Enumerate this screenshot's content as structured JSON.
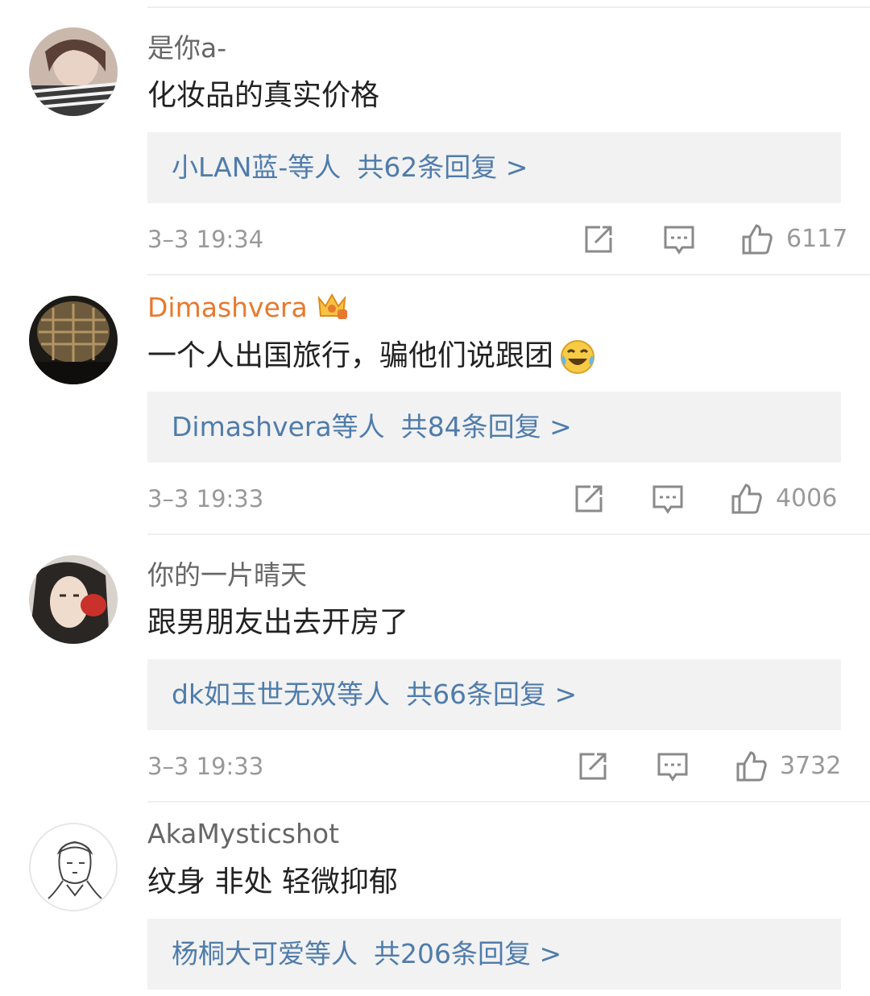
{
  "comments": [
    {
      "username": "是你a-",
      "vip": false,
      "text": "化妆品的真实价格",
      "reply_names": "小LAN蓝-等人",
      "reply_count": "共62条回复 >",
      "time": "3–3 19:34",
      "likes": "6117"
    },
    {
      "username": "Dimashvera",
      "vip": true,
      "text": "一个人出国旅行，骗他们说跟团",
      "reply_names": "Dimashvera等人",
      "reply_count": "共84条回复 >",
      "time": "3–3 19:33",
      "likes": "4006"
    },
    {
      "username": "你的一片晴天",
      "vip": false,
      "text": "跟男朋友出去开房了",
      "reply_names": "dk如玉世无双等人",
      "reply_count": "共66条回复 >",
      "time": "3–3 19:33",
      "likes": "3732"
    },
    {
      "username": "AkaMysticshot",
      "vip": false,
      "text": "纹身 非处 轻微抑郁",
      "reply_names": "杨桐大可爱等人",
      "reply_count": "共206条回复 >",
      "time": "",
      "likes": ""
    }
  ],
  "colors": {
    "reply_link": "#4f7cab",
    "vip_name": "#e8792d",
    "meta": "#999999",
    "reply_bg": "#f2f2f2"
  },
  "icons": {
    "share": "share-icon",
    "comment": "comment-icon",
    "like": "like-icon",
    "crown": "crown-icon",
    "emoji": "laughing-crying-emoji"
  }
}
